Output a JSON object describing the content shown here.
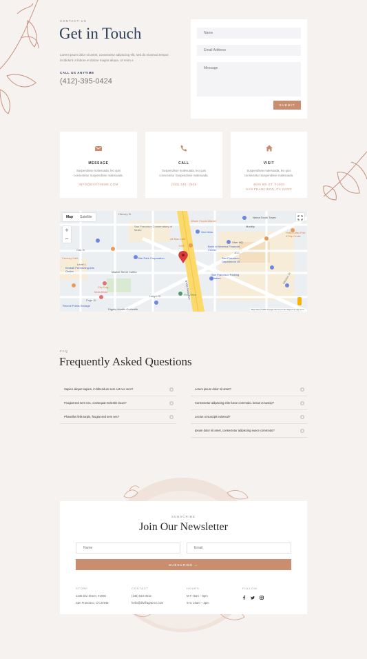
{
  "contact": {
    "eyebrow": "CONTACT US",
    "title": "Get in Touch",
    "body": "Lorem ipsum dolor sit amet, consectetur adipiscing elit, sed do eiusmod tempor incididunt ut labore et dolore magna aliqua. Ut enim a",
    "call_label": "CALL US ANYTIME",
    "phone": "(412)-395-0424"
  },
  "form": {
    "name_placeholder": "Name",
    "email_placeholder": "Email Address",
    "message_placeholder": "Message",
    "submit_label": "SUBMIT"
  },
  "info_boxes": [
    {
      "icon": "envelope-icon",
      "title": "MESSAGE",
      "text": "Suspendisse malesuada, leo quis consectetur Suspendisse malesuada.",
      "link": "INFO@DIVITHEME.COM"
    },
    {
      "icon": "phone-icon",
      "title": "CALL",
      "text": "Suspendisse malesuada, leo quis consectetur Suspendisse malesuada.",
      "link": "(333) 346 -2836"
    },
    {
      "icon": "home-icon",
      "title": "VISIT",
      "text": "Suspendisse malesuada, leo quis consectetur Suspendisse malesuada.",
      "link": "4505 8th ST. #1000",
      "link2": "SAN FRANCISCO, CA 22333"
    }
  ],
  "map": {
    "tab_map": "Map",
    "tab_satellite": "Satellite",
    "zoom_in": "+",
    "zoom_out": "−",
    "labels": {
      "hickory": "Hickory St",
      "sf_conservatory": "San Francisco Conservatory of Music",
      "van_ness": "Van Ness",
      "whole_foods": "Whole Foods Market",
      "nema": "Nema South Tower",
      "all_star": "All Star Cafe",
      "tgif": "TGIF",
      "uber": "Uber HQ",
      "modbly": "Modbly",
      "jcc": "JCC",
      "oak": "Oak St",
      "boa": "Bank of America Financial Center",
      "fedex": "FedEx Office Print & Ship Center",
      "century": "Century Cafe",
      "star_park": "Star Park Corporation",
      "sf_dept": "San Francisco Department Of",
      "level1": "Level 1",
      "kimball": "Kimball Performing Arts Center",
      "market": "Market Street Coffee",
      "sf_parking": "San Francisco Parking Citation",
      "city_dog": "City Dog",
      "bella": "Bella Bride",
      "page": "Page St",
      "svn": "SVN West",
      "haight": "Haight St",
      "recruit": "Recruit Public Storage",
      "dignity": "Dignity Health-GoHealth",
      "van_ness_ave": "S Van Ness Ave",
      "mission": "Mission St",
      "footer": "Map data ©2020 Google  Terms of Use  Report a map error"
    }
  },
  "faq": {
    "eyebrow": "FAQ",
    "title": "Frequently Asked Questions",
    "left": [
      "Sapien aliquet sapien, in bibendum sem est nec sem?",
      "Feugiat sed sem nec, consequat molestie lacus?",
      "Phasellus felis turpis, feugiat sed sem nec?"
    ],
    "right": [
      "Lorem ipsum dolor sit amet?",
      "Consectetur adipiscing elitv fusce commodo. lectus ut suscip?",
      "Lectus ut suscipit euismod?",
      "Ipsum dolor sit amet, consectetur adipiscing eusce commodo?"
    ]
  },
  "newsletter": {
    "eyebrow": "SUBSCRIBE",
    "title": "Join Our Newsletter",
    "name_placeholder": "Name",
    "email_placeholder": "Email",
    "subscribe_label": "SUBSCRIBE →"
  },
  "footer": {
    "store_h": "STORE",
    "store_1": "1235 Divi Street, #1000",
    "store_2": "San Francisco, CA 24946",
    "contact_h": "CONTACT",
    "contact_1": "(135) 523-3513",
    "contact_2": "hello@divifragrance.com",
    "hours_h": "HOURS",
    "hours_1": "M-F: 9am – 6pm",
    "hours_2": "S-S: 10am – 3pm",
    "follow_h": "FOLLOW",
    "social": [
      "f",
      "t",
      "ig"
    ]
  },
  "colors": {
    "accent": "#c98e6f",
    "navy": "#2e3f5c",
    "text": "#3a3a3a"
  }
}
